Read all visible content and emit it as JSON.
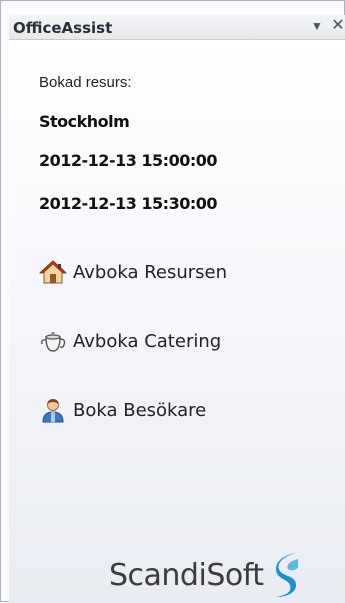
{
  "titlebar": {
    "title": "OfficeAssist",
    "dropdown_glyph": "▼",
    "close_glyph": "✕"
  },
  "booking": {
    "label": "Bokad resurs:",
    "location": "Stockholm",
    "start": "2012-12-13 15:00:00",
    "end": "2012-12-13 15:30:00"
  },
  "actions": [
    {
      "label": "Avboka Resursen",
      "icon": "house-icon"
    },
    {
      "label": "Avboka Catering",
      "icon": "teapot-icon"
    },
    {
      "label": "Boka Besökare",
      "icon": "person-icon"
    }
  ],
  "footer": {
    "logo_text": "ScandiSoft",
    "logo_color": "#1a8fd6"
  }
}
